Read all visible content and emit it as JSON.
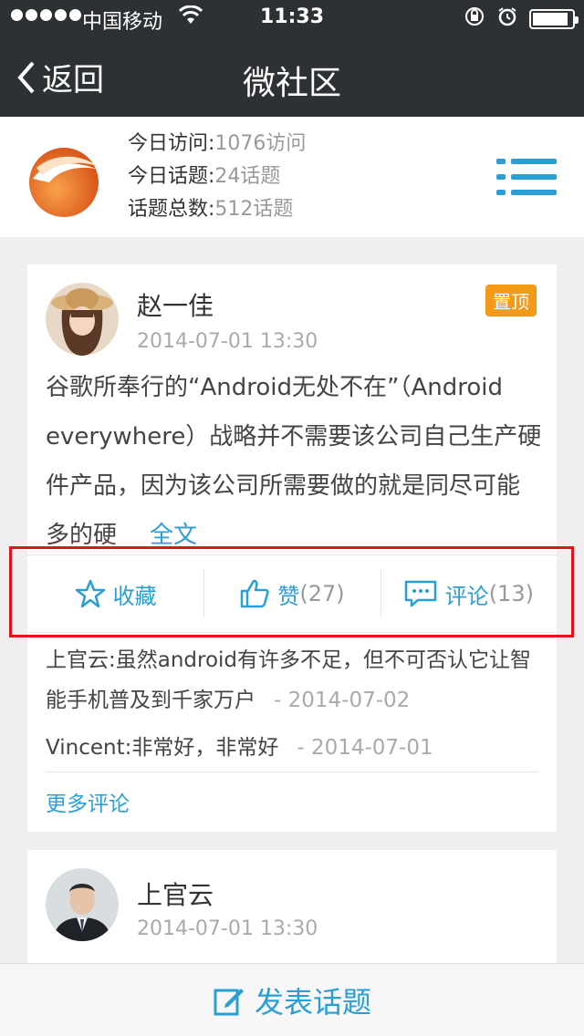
{
  "status": {
    "carrier": "中国移动",
    "time": "11:33",
    "wifi_icon": "wifi-icon",
    "battery_level": 0.9
  },
  "nav": {
    "back_label": "返回",
    "title": "微社区"
  },
  "community": {
    "visits_label": "今日访问:",
    "visits_value": "1076访问",
    "topics_label": "今日话题:",
    "topics_value": "24话题",
    "total_label": "话题总数:",
    "total_value": "512话题"
  },
  "post": {
    "author": "赵一佳",
    "datetime": "2014-07-01 13:30",
    "badge": "置顶",
    "content": "谷歌所奉行的“Android无处不在”（Android everywhere）战略并不需要该公司自己生产硬件产品，因为该公司所需要做的就是同尽可能多的硬",
    "full_text_link": "全文",
    "actions": {
      "favorite_label": "收藏",
      "like_label": "赞",
      "like_count": "(27)",
      "comment_label": "评论",
      "comment_count": "(13)"
    },
    "comments": [
      {
        "author": "上官云",
        "text": "虽然android有许多不足，但不可否认它让智能手机普及到千家万户",
        "date": "- 2014-07-02"
      },
      {
        "author": "Vincent",
        "text": "非常好，非常好",
        "date": "- 2014-07-01"
      }
    ],
    "more_comments": "更多评论"
  },
  "post2": {
    "author": "上官云",
    "datetime": "2014-07-01 13:30"
  },
  "bottom": {
    "publish_label": "发表话题"
  },
  "colors": {
    "accent": "#2a9fd6",
    "nav_bg": "#2e3133",
    "badge": "#f39a18",
    "highlight": "#e0141e"
  }
}
